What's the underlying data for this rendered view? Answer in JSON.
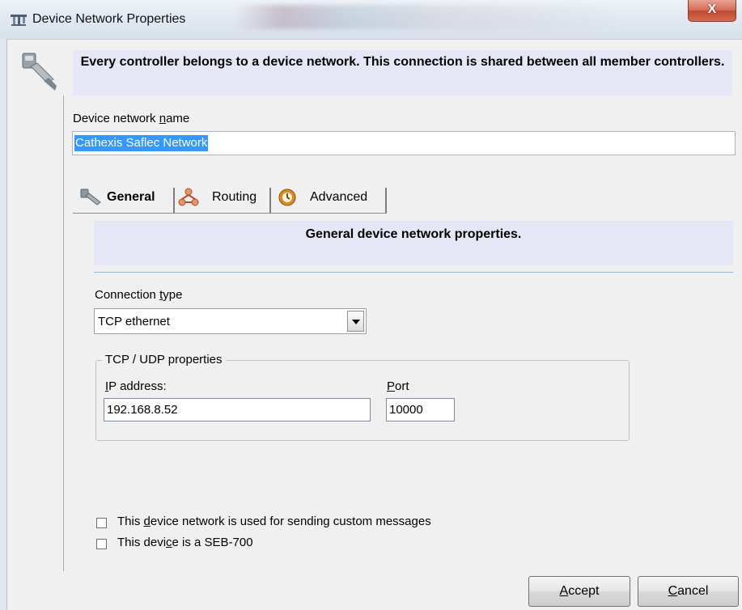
{
  "window": {
    "title": "Device Network Properties",
    "close_label": "X"
  },
  "header": {
    "message": "Every controller belongs to a device network. This connection is shared between all member controllers."
  },
  "device_network_name": {
    "label_pre": "Device network ",
    "label_accel": "n",
    "label_post": "ame",
    "value": "Cathexis Saflec Network"
  },
  "tabs": [
    {
      "label": "General",
      "icon": "plug-icon",
      "active": true
    },
    {
      "label": "Routing",
      "icon": "routing-icon",
      "active": false
    },
    {
      "label": "Advanced",
      "icon": "advanced-icon",
      "active": false
    }
  ],
  "general": {
    "banner": "General device network properties.",
    "connection_type": {
      "label_pre": "Connection ",
      "label_accel": "t",
      "label_post": "ype",
      "value": "TCP ethernet"
    },
    "tcp_group": {
      "title": "TCP / UDP properties",
      "ip_label_accel": "I",
      "ip_label_post": "P address:",
      "ip_value": "192.168.8.52",
      "port_label_accel": "P",
      "port_label_post": "ort",
      "port_value": "10000"
    },
    "options": [
      {
        "pre": "This ",
        "accel": "d",
        "post": "evice network is used for sending custom messages",
        "checked": false
      },
      {
        "pre": "This devi",
        "accel": "c",
        "post": "e is a SEB-700",
        "checked": false
      }
    ]
  },
  "buttons": {
    "accept_accel": "A",
    "accept_post": "ccept",
    "cancel_accel": "C",
    "cancel_post": "ancel"
  },
  "colors": {
    "banner": "#e5e7f7",
    "selection": "#3399ff",
    "close": "#c9503a"
  }
}
